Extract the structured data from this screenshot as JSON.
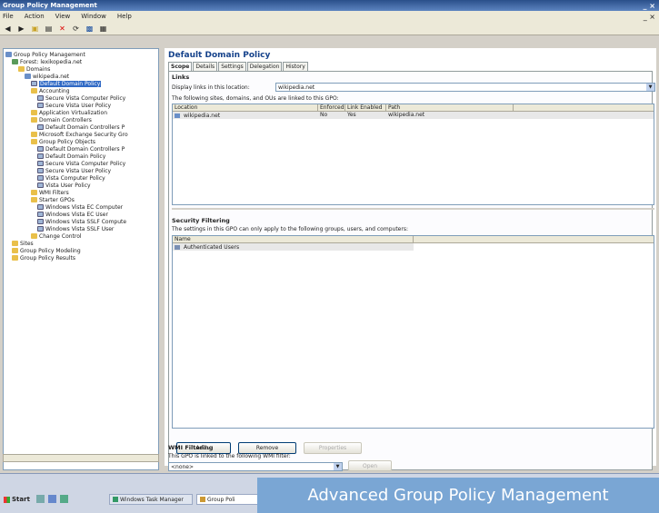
{
  "window": {
    "title": "Group Policy Management",
    "controls": "_ ×"
  },
  "menu": {
    "items": [
      "File",
      "Action",
      "View",
      "Window",
      "Help"
    ],
    "mdi_controls": "_ ×"
  },
  "tree": {
    "items": [
      {
        "label": "Group Policy Management",
        "icon": "gpm-icon",
        "indent": 0
      },
      {
        "label": "Forest: lexikopedia.net",
        "icon": "forest-icon",
        "indent": 1
      },
      {
        "label": "Domains",
        "icon": "folder-icon",
        "indent": 2
      },
      {
        "label": "wikipedia.net",
        "icon": "domain-icon",
        "indent": 3
      },
      {
        "label": "Default Domain Policy",
        "icon": "gpo-icon",
        "indent": 4,
        "selected": true
      },
      {
        "label": "Accounting",
        "icon": "folder-icon",
        "indent": 4
      },
      {
        "label": "Secure Vista Computer Policy",
        "icon": "gpo-icon",
        "indent": 5
      },
      {
        "label": "Secure Vista User Policy",
        "icon": "gpo-icon",
        "indent": 5
      },
      {
        "label": "Application Virtualization",
        "icon": "folder-icon",
        "indent": 4
      },
      {
        "label": "Domain Controllers",
        "icon": "folder-icon",
        "indent": 4
      },
      {
        "label": "Default Domain Controllers P",
        "icon": "gpo-icon",
        "indent": 5
      },
      {
        "label": "Microsoft Exchange Security Gro",
        "icon": "folder-icon",
        "indent": 4
      },
      {
        "label": "Group Policy Objects",
        "icon": "folder-icon",
        "indent": 4
      },
      {
        "label": "Default Domain Controllers P",
        "icon": "gpo-icon",
        "indent": 5
      },
      {
        "label": "Default Domain Policy",
        "icon": "gpo-icon",
        "indent": 5
      },
      {
        "label": "Secure Vista Computer Policy",
        "icon": "gpo-icon",
        "indent": 5
      },
      {
        "label": "Secure Vista User Policy",
        "icon": "gpo-icon",
        "indent": 5
      },
      {
        "label": "Vista Computer Policy",
        "icon": "gpo-icon",
        "indent": 5
      },
      {
        "label": "Vista User Policy",
        "icon": "gpo-icon",
        "indent": 5
      },
      {
        "label": "WMI Filters",
        "icon": "folder-icon",
        "indent": 4
      },
      {
        "label": "Starter GPOs",
        "icon": "folder-icon",
        "indent": 4
      },
      {
        "label": "Windows Vista EC Computer",
        "icon": "gpo-icon",
        "indent": 5
      },
      {
        "label": "Windows Vista EC User",
        "icon": "gpo-icon",
        "indent": 5
      },
      {
        "label": "Windows Vista SSLF Compute",
        "icon": "gpo-icon",
        "indent": 5
      },
      {
        "label": "Windows Vista SSLF User",
        "icon": "gpo-icon",
        "indent": 5
      },
      {
        "label": "Change Control",
        "icon": "folder-icon",
        "indent": 4
      },
      {
        "label": "Sites",
        "icon": "folder-icon",
        "indent": 1
      },
      {
        "label": "Group Policy Modeling",
        "icon": "folder-icon",
        "indent": 1
      },
      {
        "label": "Group Policy Results",
        "icon": "folder-icon",
        "indent": 1
      }
    ]
  },
  "main": {
    "title": "Default Domain Policy",
    "tabs": [
      "Scope",
      "Details",
      "Settings",
      "Delegation",
      "History"
    ],
    "links": {
      "heading": "Links",
      "display_label": "Display links in this location:",
      "location_value": "wikipedia.net",
      "note": "The following sites, domains, and OUs are linked to this GPO:",
      "columns": [
        "Location",
        "Enforced",
        "Link Enabled",
        "Path"
      ],
      "rows": [
        {
          "location": "wikipedia.net",
          "enforced": "No",
          "link_enabled": "Yes",
          "path": "wikipedia.net"
        }
      ]
    },
    "security": {
      "heading": "Security Filtering",
      "note": "The settings in this GPO can only apply to the following groups, users, and computers:",
      "column": "Name",
      "rows": [
        "Authenticated Users"
      ],
      "buttons": {
        "add": "Add...",
        "remove": "Remove",
        "properties": "Properties"
      }
    },
    "wmi": {
      "heading": "WMI Filtering",
      "note": "This GPO is linked to the following WMI filter:",
      "value": "<none>",
      "open_label": "Open"
    }
  },
  "taskbar": {
    "start": "Start",
    "tasks": [
      "Windows Task Manager",
      "Group Poli"
    ]
  },
  "banner": {
    "text": "Advanced Group Policy Management"
  }
}
